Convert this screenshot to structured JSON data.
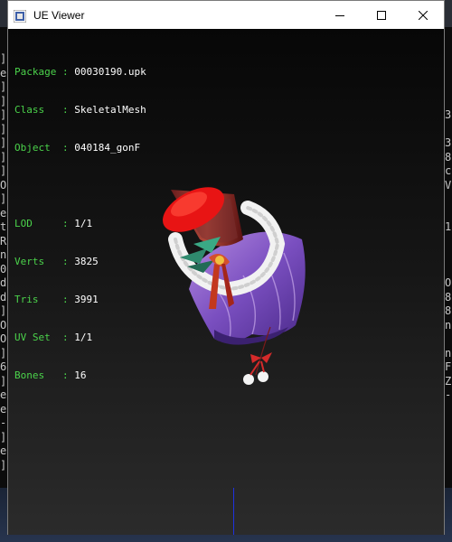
{
  "window": {
    "title": "UE Viewer"
  },
  "caption": {
    "minimize": "minimize-icon",
    "maximize": "maximize-icon",
    "close": "close-icon"
  },
  "info": {
    "package": {
      "label": "Package",
      "value": "00030190.upk"
    },
    "class": {
      "label": "Class  ",
      "value": "SkeletalMesh"
    },
    "object": {
      "label": "Object ",
      "value": "040184_gonF"
    },
    "lod": {
      "label": "LOD    ",
      "value": "1/1"
    },
    "verts": {
      "label": "Verts  ",
      "value": "3825"
    },
    "tris": {
      "label": "Tris   ",
      "value": "3991"
    },
    "uvset": {
      "label": "UV Set ",
      "value": "1/1"
    },
    "bones": {
      "label": "Bones  ",
      "value": "16"
    }
  },
  "console": {
    "left": "]\ne\n]\n]\n]\n]\n]\n]\n]\nO\n]\ne\nt\nR\nn\n0\nd\nd\n]\nO\nO\n]\n6\n]\ne\ne\n-\n]\ne\n]",
    "right": "3\n\n3\n8\nc\nV\n\n\n1\n\n\n\nO\n8\n8\nn\n\nn\nF\nZ\n-"
  },
  "colors": {
    "label": "#4bd34b",
    "value": "#ffffff",
    "axis": "#1e32e0"
  }
}
